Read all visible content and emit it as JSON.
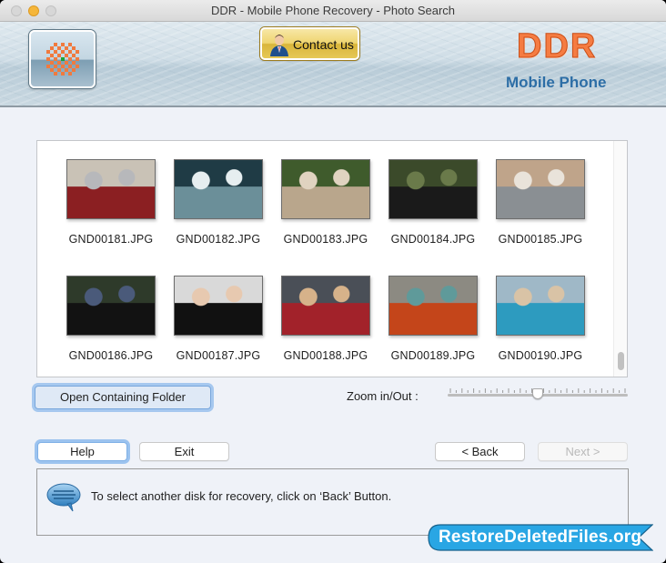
{
  "window": {
    "title": "DDR - Mobile Phone Recovery - Photo Search"
  },
  "banner": {
    "contact_label": "Contact us",
    "brand": "DDR",
    "subtitle": "Mobile Phone"
  },
  "colors": {
    "brand_orange": "#f57c42",
    "brand_blue": "#2d6ea6",
    "ribbon_blue": "#2aa8e6",
    "focus_blue": "#9cc3ef"
  },
  "gallery": {
    "items": [
      {
        "name": "GND00181.JPG",
        "icon": "photo-thumbnail"
      },
      {
        "name": "GND00182.JPG",
        "icon": "photo-thumbnail"
      },
      {
        "name": "GND00183.JPG",
        "icon": "photo-thumbnail"
      },
      {
        "name": "GND00184.JPG",
        "icon": "photo-thumbnail"
      },
      {
        "name": "GND00185.JPG",
        "icon": "photo-thumbnail"
      },
      {
        "name": "GND00186.JPG",
        "icon": "photo-thumbnail"
      },
      {
        "name": "GND00187.JPG",
        "icon": "photo-thumbnail"
      },
      {
        "name": "GND00188.JPG",
        "icon": "photo-thumbnail"
      },
      {
        "name": "GND00189.JPG",
        "icon": "photo-thumbnail"
      },
      {
        "name": "GND00190.JPG",
        "icon": "photo-thumbnail"
      }
    ]
  },
  "controls": {
    "open_folder_label": "Open Containing Folder",
    "zoom_label": "Zoom in/Out :",
    "zoom_value_fraction": 0.5
  },
  "footer": {
    "help_label": "Help",
    "exit_label": "Exit",
    "back_label": "< Back",
    "next_label": "Next >",
    "info_icon": "speech-bubble-icon",
    "info_text": "To select another disk for recovery, click on ‘Back’ Button."
  },
  "watermark": {
    "text": "RestoreDeletedFiles.org"
  }
}
